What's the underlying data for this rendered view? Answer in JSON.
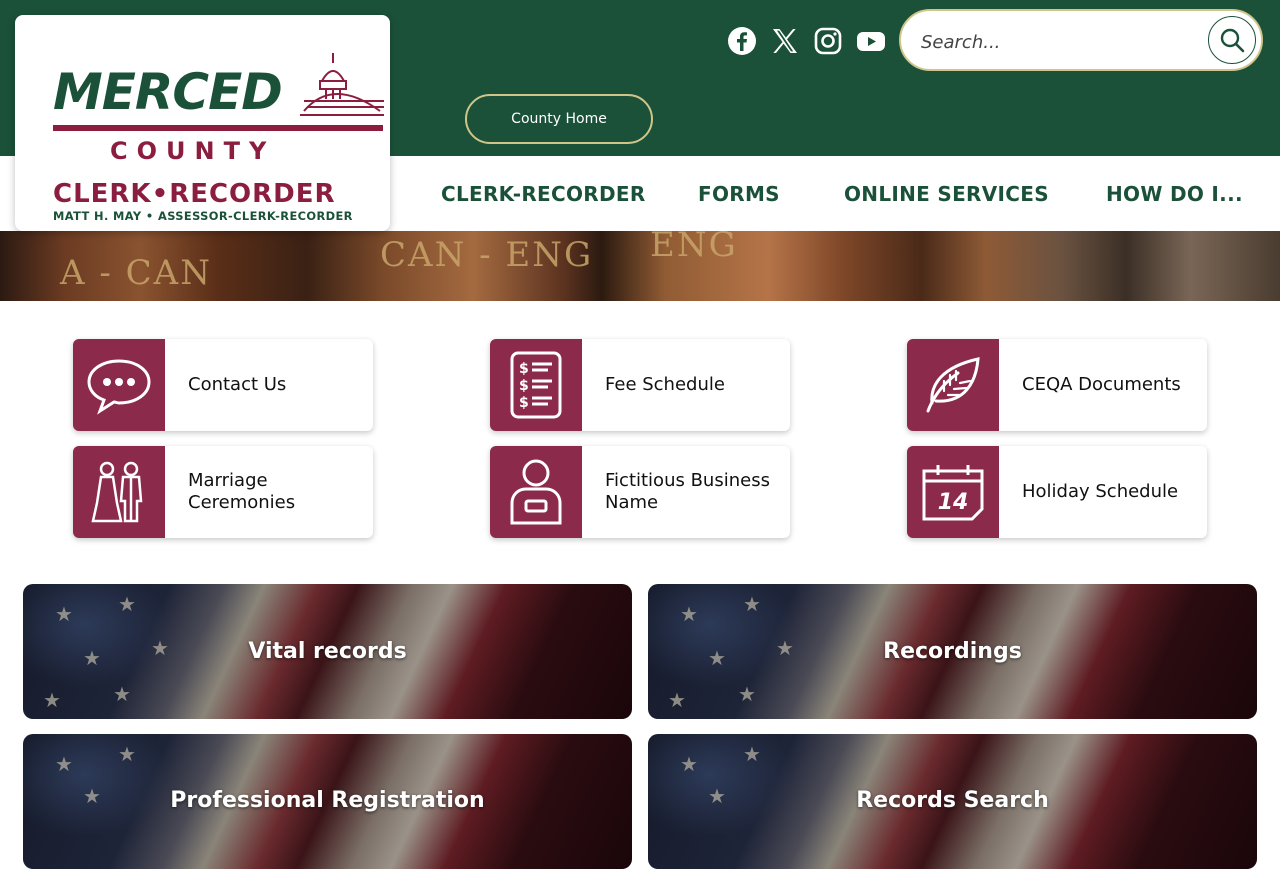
{
  "header": {
    "logo": {
      "line1": "MERCED",
      "line2": "COUNTY",
      "line3": "CLERK•RECORDER",
      "line4": "MATT H. MAY • ASSESSOR-CLERK-RECORDER",
      "brand_green": "#1b5139",
      "brand_maroon": "#8b1e3f"
    },
    "social": [
      "facebook-icon",
      "x-icon",
      "instagram-icon",
      "youtube-icon"
    ],
    "search": {
      "placeholder": "Search..."
    },
    "county_home_label": "County Home"
  },
  "nav": {
    "items": [
      {
        "label": "CLERK-RECORDER"
      },
      {
        "label": "FORMS"
      },
      {
        "label": "ONLINE SERVICES"
      },
      {
        "label": "HOW DO I..."
      }
    ]
  },
  "banner": {
    "text1": "A - CAN",
    "text2": "CAN - ENG",
    "text3": "ENG"
  },
  "quick_links": [
    {
      "label": "Contact Us",
      "icon": "speech-bubble-icon"
    },
    {
      "label": "Fee Schedule",
      "icon": "fee-list-icon"
    },
    {
      "label": "CEQA Documents",
      "icon": "leaf-icon"
    },
    {
      "label": "Marriage Ceremonies",
      "icon": "couple-icon"
    },
    {
      "label": "Fictitious Business Name",
      "icon": "person-badge-icon"
    },
    {
      "label": "Holiday Schedule",
      "icon": "calendar-icon"
    }
  ],
  "calendar_day": "14",
  "cards": [
    {
      "label": "Vital records"
    },
    {
      "label": "Recordings"
    },
    {
      "label": "Professional Registration"
    },
    {
      "label": "Records Search"
    }
  ],
  "colors": {
    "tile_icon_bg": "#8b2a4a",
    "accent_gold": "#cfc58a"
  }
}
